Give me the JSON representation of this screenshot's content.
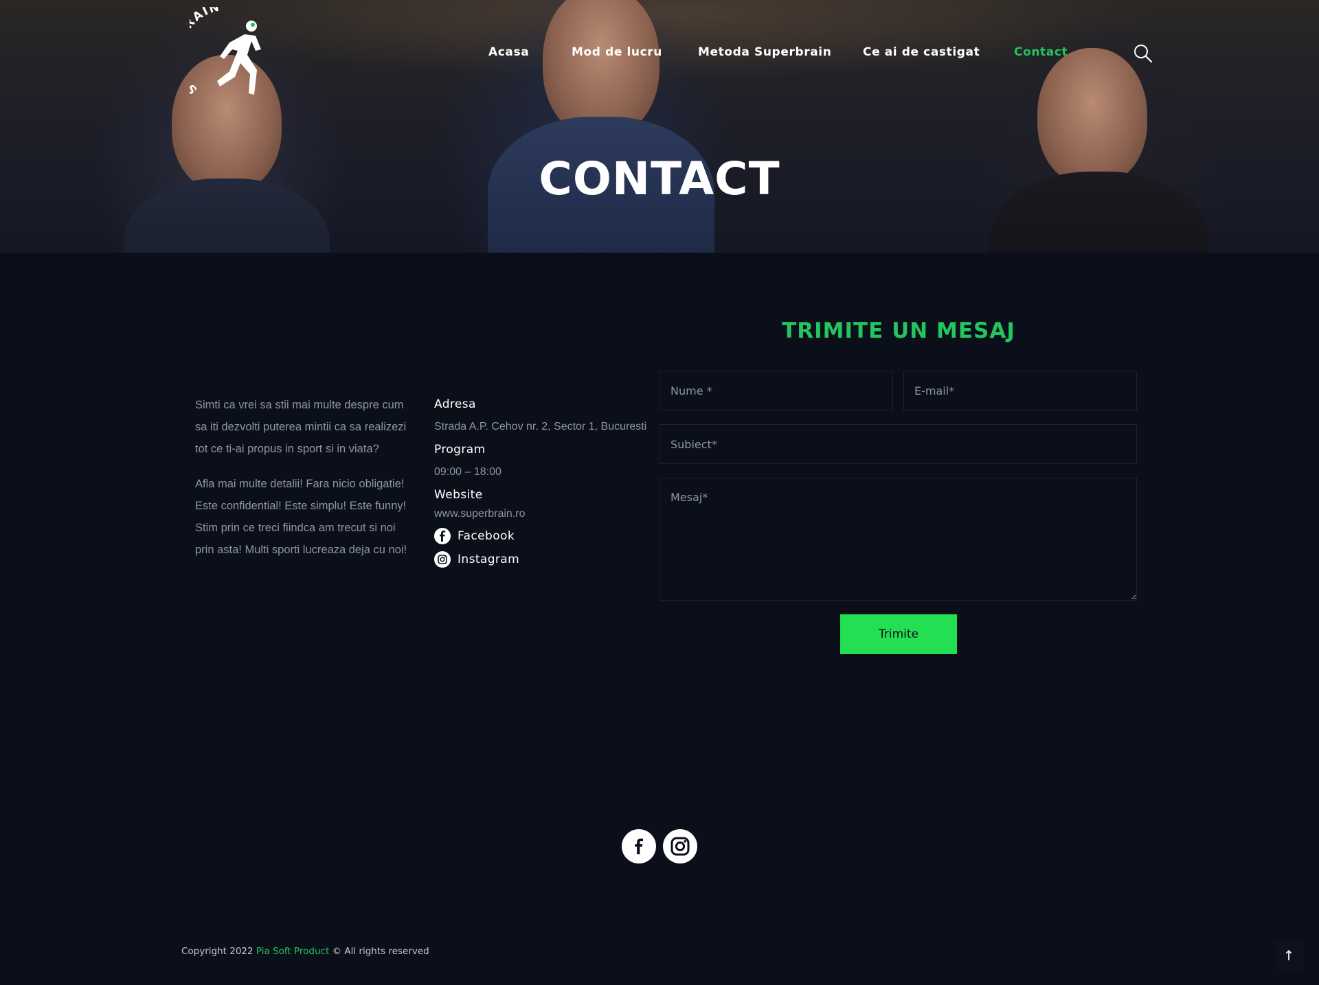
{
  "brand": {
    "logo_text": "SUPER BRAIN",
    "accent_color": "#22c55e",
    "button_color": "#22e052",
    "background_color": "#0b0f1a"
  },
  "nav": {
    "items": [
      {
        "label": "Acasa",
        "active": false
      },
      {
        "label": "Mod de lucru",
        "active": false
      },
      {
        "label": "Metoda Superbrain",
        "active": false
      },
      {
        "label": "Ce ai de castigat",
        "active": false
      },
      {
        "label": "Contact",
        "active": true
      }
    ],
    "search_icon": "search-icon"
  },
  "hero": {
    "title": "CONTACT"
  },
  "intro": {
    "paragraph1": "Simti ca vrei sa stii mai multe despre cum sa iti dezvolti puterea mintii ca sa realizezi tot ce ti-ai propus in sport si in viata?",
    "paragraph2": "Afla mai multe detalii! Fara nicio obligatie! Este confidential! Este simplu! Este funny! Stim prin ce treci fiindca am trecut si noi prin asta! Multi sporti lucreaza deja cu noi!"
  },
  "contact_info": {
    "address_label": "Adresa",
    "address_value": "Strada A.P. Cehov nr. 2, Sector 1, Bucuresti",
    "program_label": "Program",
    "program_value": "09:00 – 18:00",
    "website_label": "Website",
    "website_value": "www.superbrain.ro",
    "facebook_label": "Facebook",
    "instagram_label": "Instagram"
  },
  "form": {
    "title": "TRIMITE UN MESAJ",
    "name_placeholder": "Nume *",
    "email_placeholder": "E-mail*",
    "subject_placeholder": "Subiect*",
    "message_placeholder": "Mesaj*",
    "submit_label": "Trimite"
  },
  "footer": {
    "copyright_prefix": "Copyright 2022",
    "copyright_link": "Pia Soft Product",
    "copyright_suffix": "© All rights reserved",
    "back_to_top": "↑"
  }
}
